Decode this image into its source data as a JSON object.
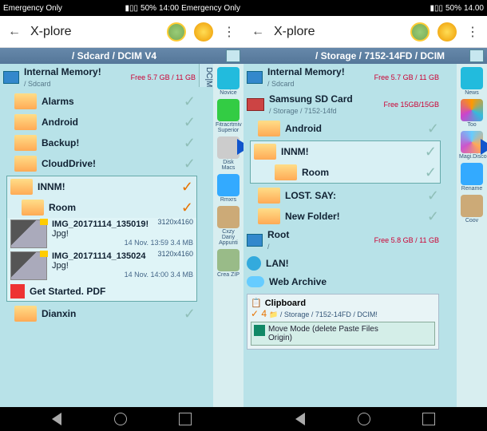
{
  "status": {
    "carrier": "Emergency Only",
    "battery": "50%",
    "time_l": "14:00",
    "time_r": "14.00"
  },
  "app_title": "X-plore",
  "left": {
    "path": "/ Sdcard / DCIM V4",
    "vtab": "DC|M",
    "internal": {
      "label": "Internal Memory!",
      "sub": "/ Sdcard",
      "free": "Free 5.7 GB / 11 GB"
    },
    "folders": [
      "Alarms",
      "Android",
      "Backup!",
      "CloudDrive!"
    ],
    "sel_folder": "INNM!",
    "sel_sub": "Room",
    "files": [
      {
        "name": "IMG_20171114_135019!",
        "ext": "Jpg!",
        "dims": "3120x4160",
        "date": "14 Nov. 13:59 3.4 MB"
      },
      {
        "name": "IMG_20171114_135024",
        "ext": "Jpg!",
        "dims": "3120x4160",
        "date": "14 Nov. 14:00 3.4 MB"
      }
    ],
    "pdf": "Get Started. PDF",
    "bottom_folder": "Dianxin",
    "tools": [
      {
        "label": "Novice",
        "color": "#2bd"
      },
      {
        "label": "Fitracrtmiv Superior",
        "color": "#3c4"
      },
      {
        "label": "Disk Macs",
        "color": "#ccc"
      },
      {
        "label": "Rmxrs",
        "color": "#3af"
      },
      {
        "label": "Cxzy Dany Appunti",
        "color": "#ca7"
      },
      {
        "label": "Crea ZIP",
        "color": "#9b8"
      }
    ]
  },
  "right": {
    "path": "/ Storage / 7152-14FD / DCIM",
    "internal": {
      "label": "Internal Memory!",
      "sub": "/ Sdcard",
      "free": "Free 5.7 GB / 11 GB"
    },
    "sdcard": {
      "label": "Samsung SD Card",
      "sub": "/ Storage / 7152-14fd",
      "free": "Free 15GB/15GB"
    },
    "folders_top": [
      "Android"
    ],
    "sel_folder": "INNM!",
    "sel_sub": "Room",
    "folders_mid": [
      "LOST. SAY:",
      "New Folder!"
    ],
    "root": {
      "label": "Root",
      "sub": "/",
      "free": "Free 5.8 GB / 11 GB"
    },
    "lan": "LAN!",
    "cloud": "Web Archive",
    "clipboard": {
      "title": "Clipboard",
      "count": "4",
      "path": "/ Storage / 7152-14FD / DCIM!",
      "move": "Move Mode (delete Paste Files",
      "origin": "Origin)"
    },
    "tools": [
      {
        "label": "News",
        "color": "#2bd"
      },
      {
        "label": "Too",
        "color": "#f90,#3bd,#c4c"
      },
      {
        "label": "Magi.Disco",
        "color": "#ccc"
      },
      {
        "label": "Rename",
        "color": "#3af"
      },
      {
        "label": "Coov",
        "color": "#ca7"
      }
    ]
  }
}
